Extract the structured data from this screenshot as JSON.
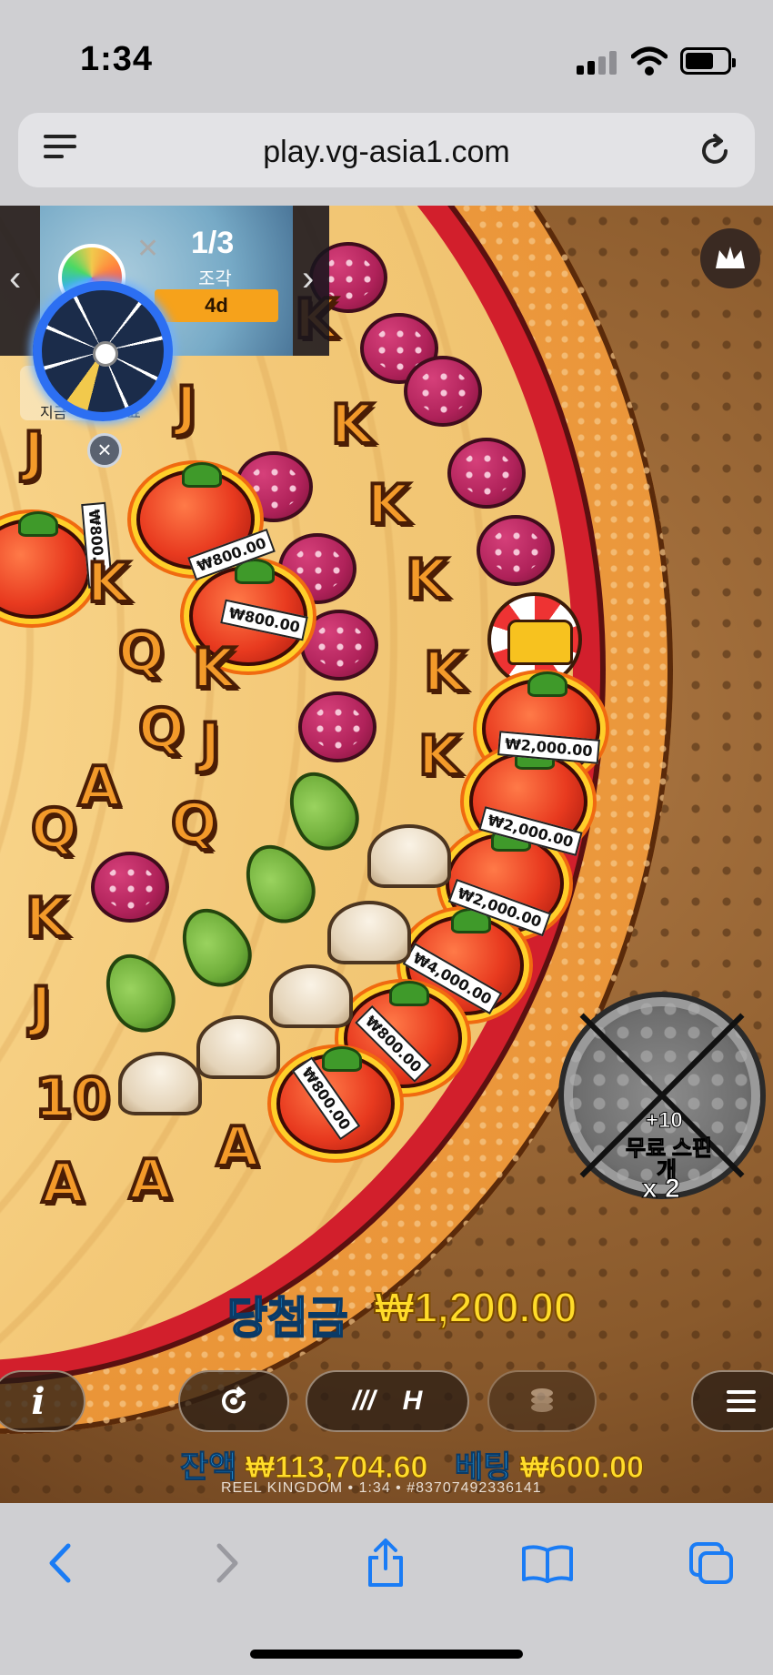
{
  "status_bar": {
    "time": "1:34"
  },
  "browser": {
    "url": "play.vg-asia1.com"
  },
  "promo": {
    "count": "1/3",
    "label": "조각",
    "badge": "4d",
    "mini_text_left": "지금",
    "mini_text_right": "료"
  },
  "game": {
    "symbols_letters": [
      "J",
      "K",
      "Q",
      "A",
      "10"
    ],
    "multiplier_values": [
      "₩800.00",
      "₩800.00",
      "₩800.00",
      "₩2,000.00",
      "₩2,000.00",
      "₩2,000.00",
      "₩4,000.00",
      "₩800.00",
      "₩800.00"
    ],
    "free_spins": {
      "plus": "+10",
      "label_line1": "무료 스핀",
      "label_line2": "개",
      "multiplier": "x 2"
    },
    "win": {
      "label": "당첨금",
      "amount": "₩1,200.00"
    },
    "controls": {
      "info": "i",
      "speed": "H"
    },
    "balance": {
      "label": "잔액",
      "value": "₩113,704.60"
    },
    "bet": {
      "label": "베팅",
      "value": "₩600.00"
    },
    "footer": "REEL KINGDOM • 1:34 • #83707492336141"
  },
  "colors": {
    "win_label": "#1c9ee8",
    "win_amount": "#ffdc2a",
    "sauce": "#d21f2c"
  }
}
